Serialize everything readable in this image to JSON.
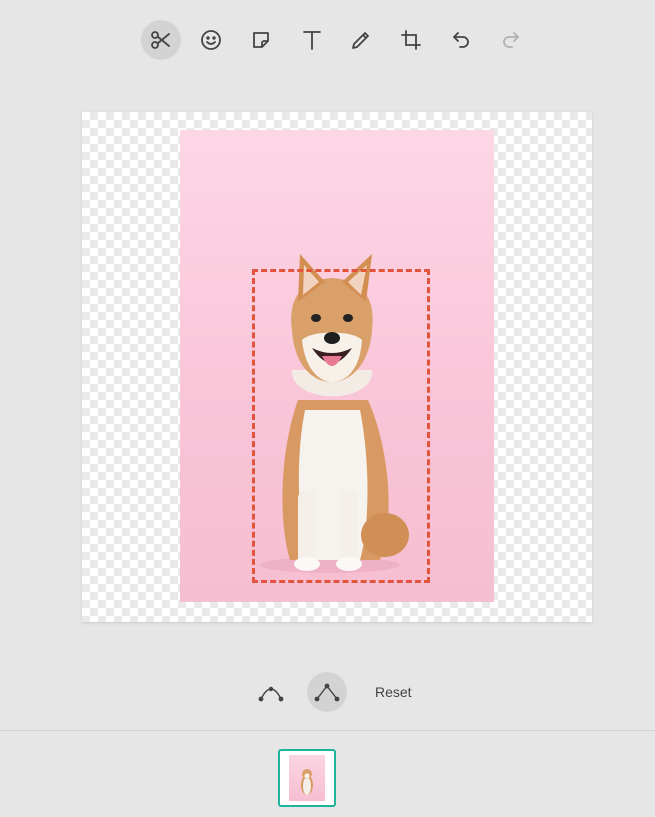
{
  "toolbar": {
    "tools": [
      {
        "name": "cut-tool",
        "icon": "scissors-icon",
        "active": true
      },
      {
        "name": "emoji-tool",
        "icon": "smiley-icon",
        "active": false
      },
      {
        "name": "sticker-tool",
        "icon": "sticker-icon",
        "active": false
      },
      {
        "name": "text-tool",
        "icon": "text-icon",
        "active": false
      },
      {
        "name": "draw-tool",
        "icon": "pencil-icon",
        "active": false
      },
      {
        "name": "crop-tool",
        "icon": "crop-icon",
        "active": false
      },
      {
        "name": "undo-button",
        "icon": "undo-icon",
        "active": false
      },
      {
        "name": "redo-button",
        "icon": "redo-icon",
        "active": false,
        "disabled": true
      }
    ]
  },
  "canvas": {
    "image_subject": "dog",
    "selection_color": "#e2553a"
  },
  "path_tools": {
    "curve_label_icon": "curve-path-icon",
    "polygon_label_icon": "polygon-path-icon",
    "reset_label": "Reset"
  },
  "thumbnails": {
    "selected_border_color": "#1fb59b"
  }
}
